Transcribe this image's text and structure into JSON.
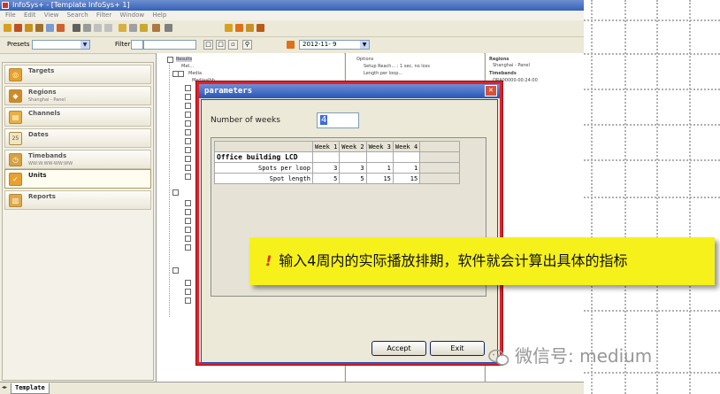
{
  "window": {
    "title": "InfoSys+ - [Template InfoSys+ 1]"
  },
  "menubar": {
    "items": [
      "File",
      "Edit",
      "View",
      "Search",
      "Filter",
      "Window",
      "Help"
    ]
  },
  "toolbar2": {
    "presets_label": "Presets",
    "filter_label": "Filter",
    "date_value": "2012-11- 9"
  },
  "sidebar": {
    "items": [
      {
        "label": "Targets",
        "sub": ""
      },
      {
        "label": "Regions",
        "sub": "Shanghai - Panel"
      },
      {
        "label": "Channels",
        "sub": ""
      },
      {
        "label": "Dates",
        "sub": ""
      },
      {
        "label": "Timebands",
        "sub": "WW:W:WW-WW:WW"
      },
      {
        "label": "Units",
        "sub": ""
      },
      {
        "label": "Reports",
        "sub": ""
      }
    ]
  },
  "tree": {
    "items": [
      "Results",
      "Met...",
      "Media",
      "Mediaalbb"
    ]
  },
  "options": {
    "items": [
      "Options",
      "Setup Reach... : 1 sec, no loss",
      "Length per loop..."
    ]
  },
  "regions_panel": {
    "items": [
      "Regions",
      "Shanghai - Panel",
      "Timebands",
      "ORA00000-00:24:00"
    ]
  },
  "dialog": {
    "title": "parameters",
    "weeks_label": "Number of weeks",
    "weeks_value": "4",
    "grid": {
      "title": "Office building LCD",
      "columns": [
        "Week 1",
        "Week 2",
        "Week 3",
        "Week 4"
      ],
      "rows": [
        {
          "label": "Spots per loop",
          "values": [
            "3",
            "3",
            "1",
            "1"
          ]
        },
        {
          "label": "Spot length",
          "values": [
            "5",
            "5",
            "15",
            "15"
          ]
        }
      ]
    },
    "accept_label": "Accept",
    "exit_label": "Exit"
  },
  "tabs": {
    "template": "Template"
  },
  "callout": {
    "bang": "!",
    "text": "输入4周内的实际播放排期，软件就会计算出具体的指标"
  },
  "watermark": {
    "text": "微信号: medium"
  },
  "colors": {
    "callout_bg": "#f6f11a",
    "dialog_border": "#e0202a",
    "titlebar": "#2656b8"
  }
}
